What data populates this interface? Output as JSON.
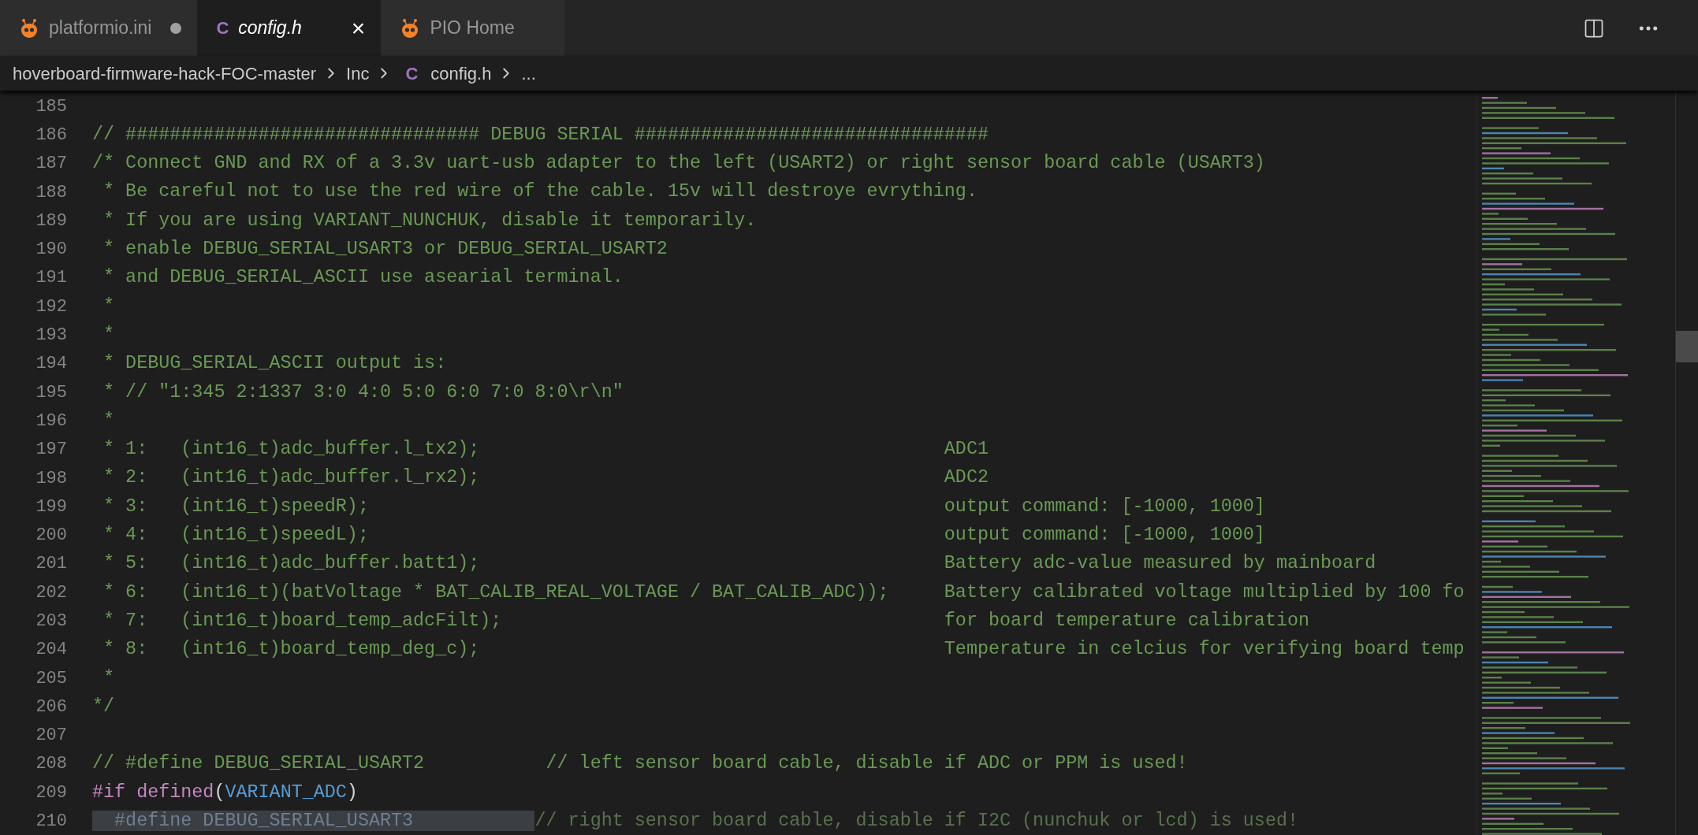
{
  "tabs": [
    {
      "label": "platformio.ini",
      "kind": "platformio",
      "selected": false,
      "modified": true,
      "italic": false
    },
    {
      "label": "config.h",
      "kind": "c",
      "icon_letter": "C",
      "selected": true,
      "modified": false,
      "italic": true,
      "close": "×"
    },
    {
      "label": "PIO Home",
      "kind": "platformio",
      "selected": false,
      "modified": false,
      "italic": false
    }
  ],
  "breadcrumb": [
    {
      "text": "hoverboard-firmware-hack-FOC-master"
    },
    {
      "text": "Inc"
    },
    {
      "icon_letter": "C",
      "text": "config.h"
    },
    {
      "text": "..."
    }
  ],
  "lines": [
    {
      "number": "185"
    },
    {
      "number": "186",
      "segments": [
        {
          "kind": "comment",
          "text": "// ################################ DEBUG SERIAL ################################"
        }
      ]
    },
    {
      "number": "187",
      "segments": [
        {
          "kind": "comment",
          "text": "/* Connect GND and RX of a 3.3v uart-usb adapter to the left (USART2) or right sensor board cable (USART3)"
        }
      ]
    },
    {
      "number": "188",
      "segments": [
        {
          "kind": "comment",
          "text": " * Be careful not to use the red wire of the cable. 15v will destroye evrything."
        }
      ]
    },
    {
      "number": "189",
      "segments": [
        {
          "kind": "comment",
          "text": " * If you are using VARIANT_NUNCHUK, disable it temporarily."
        }
      ]
    },
    {
      "number": "190",
      "segments": [
        {
          "kind": "comment",
          "text": " * enable DEBUG_SERIAL_USART3 or DEBUG_SERIAL_USART2"
        }
      ]
    },
    {
      "number": "191",
      "segments": [
        {
          "kind": "comment",
          "text": " * and DEBUG_SERIAL_ASCII use asearial terminal."
        }
      ]
    },
    {
      "number": "192",
      "segments": [
        {
          "kind": "comment",
          "text": " *"
        }
      ]
    },
    {
      "number": "193",
      "segments": [
        {
          "kind": "comment",
          "text": " *"
        }
      ]
    },
    {
      "number": "194",
      "segments": [
        {
          "kind": "comment",
          "text": " * DEBUG_SERIAL_ASCII output is:"
        }
      ]
    },
    {
      "number": "195",
      "segments": [
        {
          "kind": "comment",
          "text": " * // \"1:345 2:1337 3:0 4:0 5:0 6:0 7:0 8:0\\r\\n\""
        }
      ]
    },
    {
      "number": "196",
      "segments": [
        {
          "kind": "comment",
          "text": " *"
        }
      ]
    },
    {
      "number": "197",
      "segments": [
        {
          "kind": "comment",
          "text": " * 1:   (int16_t)adc_buffer.l_tx2);                                          ADC1"
        }
      ]
    },
    {
      "number": "198",
      "segments": [
        {
          "kind": "comment",
          "text": " * 2:   (int16_t)adc_buffer.l_rx2);                                          ADC2"
        }
      ]
    },
    {
      "number": "199",
      "segments": [
        {
          "kind": "comment",
          "text": " * 3:   (int16_t)speedR);                                                    output command: [-1000, 1000]"
        }
      ]
    },
    {
      "number": "200",
      "segments": [
        {
          "kind": "comment",
          "text": " * 4:   (int16_t)speedL);                                                    output command: [-1000, 1000]"
        }
      ]
    },
    {
      "number": "201",
      "segments": [
        {
          "kind": "comment",
          "text": " * 5:   (int16_t)adc_buffer.batt1);                                          Battery adc-value measured by mainboard"
        }
      ]
    },
    {
      "number": "202",
      "segments": [
        {
          "kind": "comment",
          "text": " * 6:   (int16_t)(batVoltage * BAT_CALIB_REAL_VOLTAGE / BAT_CALIB_ADC));     Battery calibrated voltage multiplied by 100 fo"
        }
      ]
    },
    {
      "number": "203",
      "segments": [
        {
          "kind": "comment",
          "text": " * 7:   (int16_t)board_temp_adcFilt);                                        for board temperature calibration"
        }
      ]
    },
    {
      "number": "204",
      "segments": [
        {
          "kind": "comment",
          "text": " * 8:   (int16_t)board_temp_deg_c);                                          Temperature in celcius for verifying board temp"
        }
      ]
    },
    {
      "number": "205",
      "segments": [
        {
          "kind": "comment",
          "text": " *"
        }
      ]
    },
    {
      "number": "206",
      "segments": [
        {
          "kind": "comment",
          "text": "*/"
        }
      ]
    },
    {
      "number": "207"
    },
    {
      "number": "208",
      "segments": [
        {
          "kind": "comment",
          "text": "// #define DEBUG_SERIAL_USART2           // left sensor board cable, disable if ADC or PPM is used!"
        }
      ]
    },
    {
      "number": "209",
      "segments": [
        {
          "kind": "keyword",
          "text": "#if defined"
        },
        {
          "kind": "plain",
          "text": "("
        },
        {
          "kind": "macro",
          "text": "VARIANT_ADC"
        },
        {
          "kind": "plain",
          "text": ")"
        }
      ]
    },
    {
      "number": "210",
      "segments": [
        {
          "kind": "inactive_code",
          "text": "  #define DEBUG_SERIAL_USART3           "
        },
        {
          "kind": "inactive_comment",
          "text": "// right sensor board cable, disable if I2C (nunchuk or lcd) is used!"
        }
      ]
    }
  ]
}
